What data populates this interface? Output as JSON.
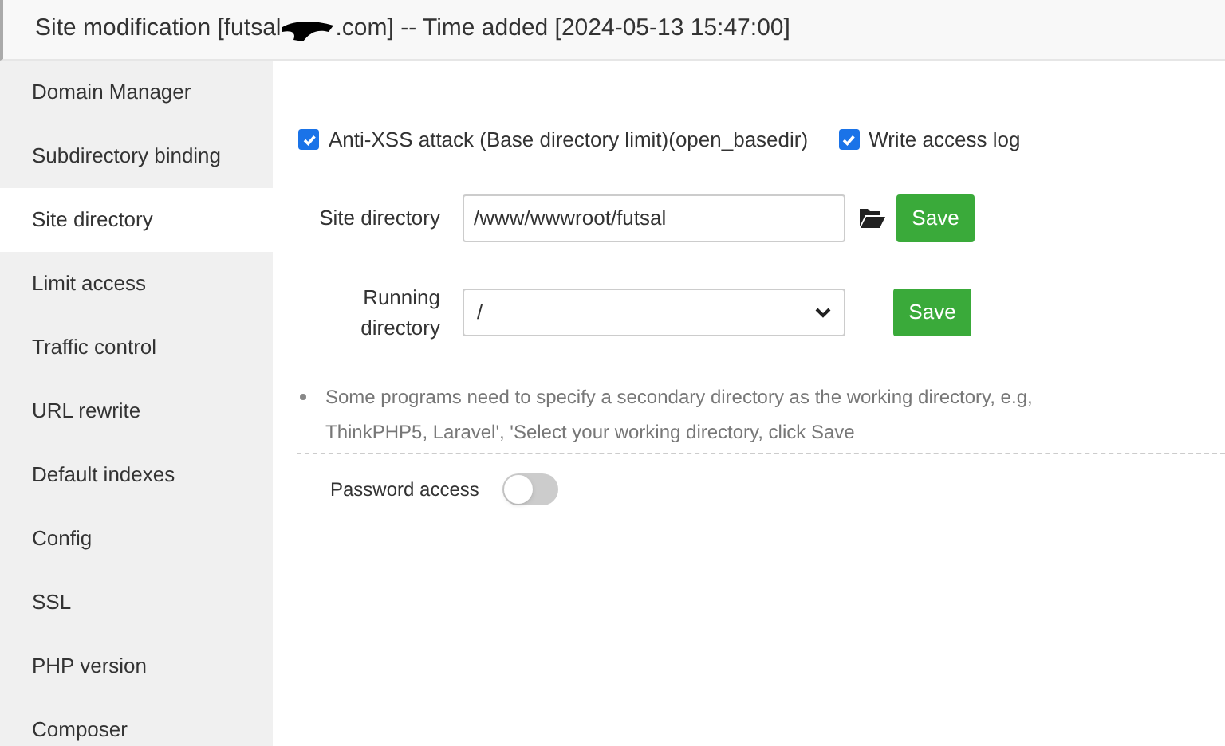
{
  "window": {
    "title_before": "Site modification [futsal",
    "title_after": ".com] -- Time added [2024-05-13 15:47:00]"
  },
  "sidebar": {
    "items": [
      {
        "label": "Domain Manager",
        "selected": false
      },
      {
        "label": "Subdirectory binding",
        "selected": false
      },
      {
        "label": "Site directory",
        "selected": true
      },
      {
        "label": "Limit access",
        "selected": false
      },
      {
        "label": "Traffic control",
        "selected": false
      },
      {
        "label": "URL rewrite",
        "selected": false
      },
      {
        "label": "Default indexes",
        "selected": false
      },
      {
        "label": "Config",
        "selected": false
      },
      {
        "label": "SSL",
        "selected": false
      },
      {
        "label": "PHP version",
        "selected": false
      },
      {
        "label": "Composer",
        "selected": false
      }
    ]
  },
  "options": [
    {
      "label": "Anti-XSS attack (Base directory limit)(open_basedir)",
      "checked": true
    },
    {
      "label": "Write access log",
      "checked": true
    }
  ],
  "site_directory": {
    "label": "Site directory",
    "value": "/www/wwwroot/futsal",
    "button": "Save"
  },
  "running_directory": {
    "label": "Running directory",
    "value": "/",
    "button": "Save"
  },
  "note": "Some programs need to specify a secondary directory as the working directory, e.g, ThinkPHP5, Laravel', 'Select your working directory, click Save",
  "password_access": {
    "label": "Password access",
    "on": false
  }
}
